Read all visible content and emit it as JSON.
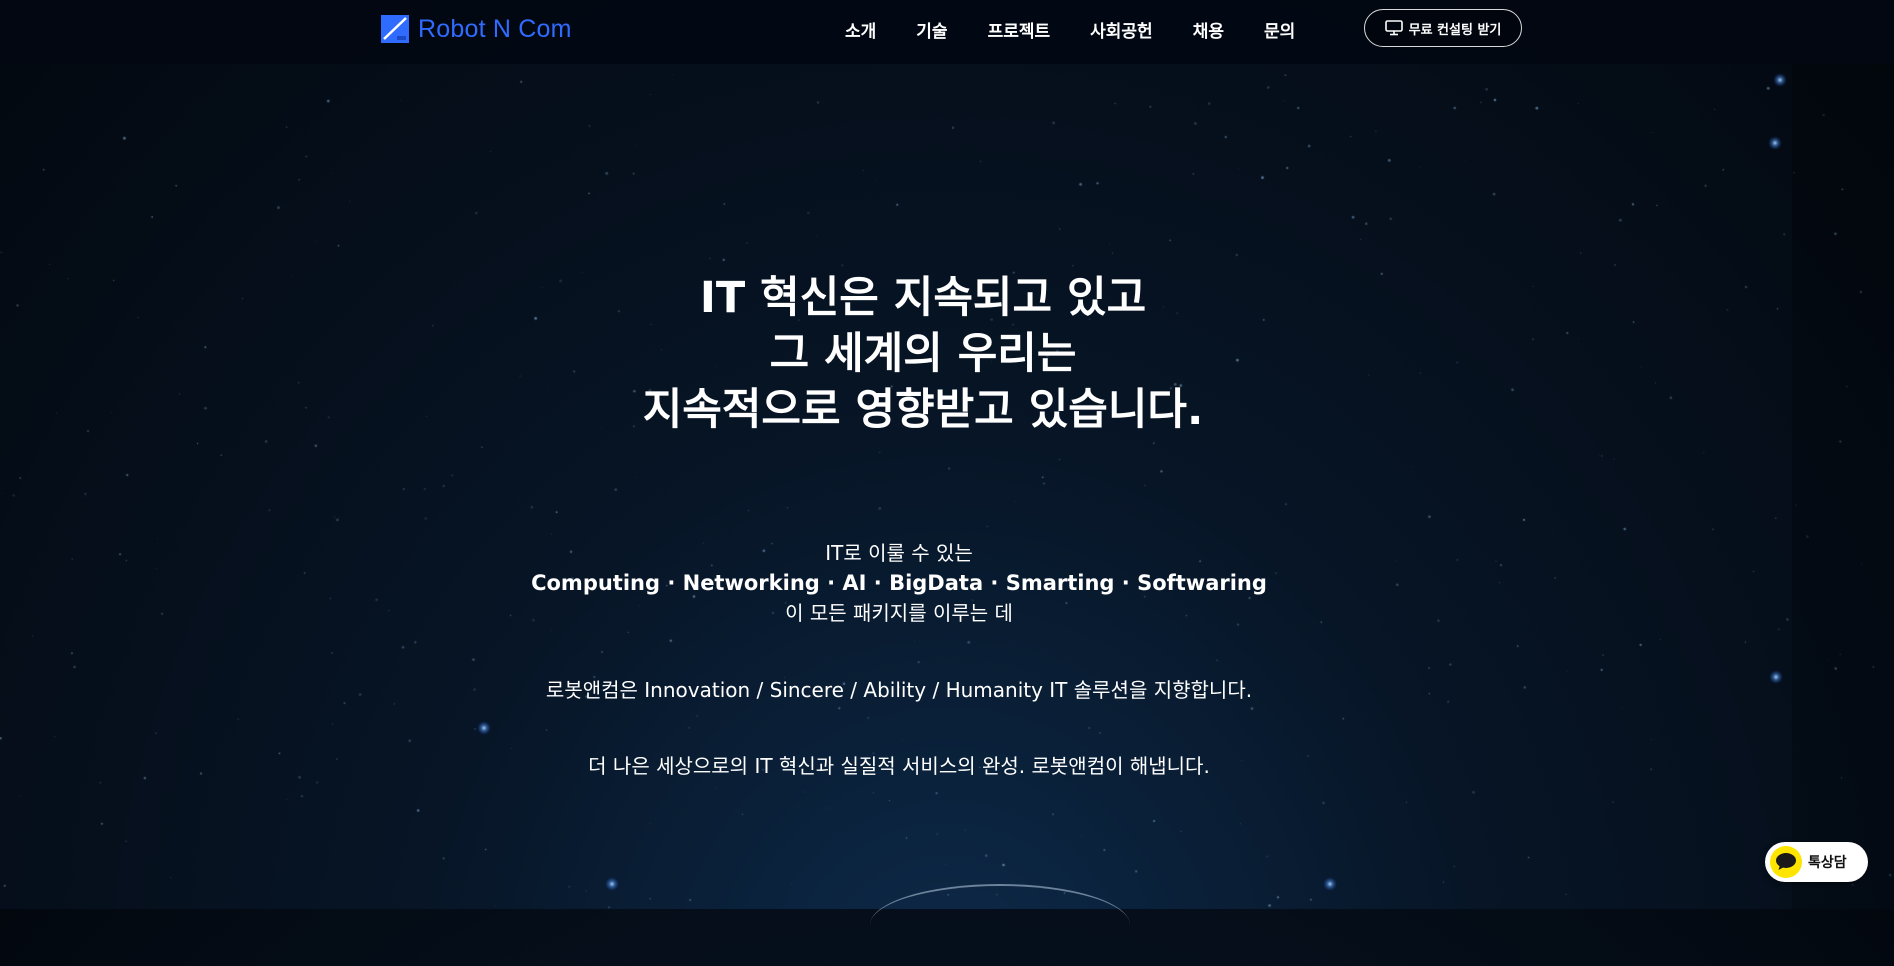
{
  "header": {
    "logo_text": "Robot N Com",
    "logo_icon": "robot-n-com-logo-mark",
    "nav": [
      {
        "label": "소개"
      },
      {
        "label": "기술"
      },
      {
        "label": "프로젝트"
      },
      {
        "label": "사회공헌"
      },
      {
        "label": "채용"
      },
      {
        "label": "문의"
      }
    ],
    "consult_button": {
      "label": "무료 컨설팅 받기",
      "icon": "monitor-icon"
    }
  },
  "hero": {
    "lines": [
      "IT 혁신은 지속되고 있고",
      "그 세계의 우리는",
      "지속적으로 영향받고 있습니다."
    ]
  },
  "intro": {
    "line1": "IT로 이룰 수 있는",
    "line2": "Computing · Networking · AI · BigData · Smarting · Softwaring",
    "line3": "이 모든 패키지를 이루는 데"
  },
  "values_statement": "로봇앤컴은 Innovation / Sincere / Ability / Humanity IT 솔루션을 지향합니다.",
  "closing_statement": "더 나은 세상으로의 IT 혁신과 실질적 서비스의 완성. 로봇앤컴이 해냅니다.",
  "chat_button": {
    "label": "톡상담",
    "icon": "kakao-chat-icon"
  },
  "colors": {
    "brand_blue": "#2f6bff",
    "background_dark": "#03080f",
    "kakao_yellow": "#fee500"
  }
}
